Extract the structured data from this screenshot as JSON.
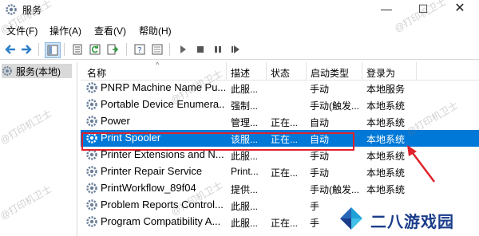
{
  "window": {
    "title": "服务",
    "minimize": "—",
    "maximize": "☐",
    "close": "✕"
  },
  "menu": [
    "文件(F)",
    "操作(A)",
    "查看(V)",
    "帮助(H)"
  ],
  "tree": {
    "root_label": "服务(本地)"
  },
  "columns": {
    "name": "名称",
    "desc": "描述",
    "status": "状态",
    "startup": "启动类型",
    "logon": "登录为"
  },
  "services": [
    {
      "name": "PNRP Machine Name Pu...",
      "desc": "此服...",
      "status": "",
      "startup": "手动",
      "logon": "本地服务"
    },
    {
      "name": "Portable Device Enumera...",
      "desc": "强制...",
      "status": "",
      "startup": "手动(触发...",
      "logon": "本地系统"
    },
    {
      "name": "Power",
      "desc": "管理...",
      "status": "正在...",
      "startup": "自动",
      "logon": "本地系统"
    },
    {
      "name": "Print Spooler",
      "desc": "该服...",
      "status": "正在...",
      "startup": "自动",
      "logon": "本地系统",
      "selected": true
    },
    {
      "name": "Printer Extensions and N...",
      "desc": "此服...",
      "status": "",
      "startup": "手动",
      "logon": "本地系统"
    },
    {
      "name": "Printer Repair Service",
      "desc": "Print...",
      "status": "正在...",
      "startup": "手动",
      "logon": "本地系统"
    },
    {
      "name": "PrintWorkflow_89f04",
      "desc": "提供...",
      "status": "",
      "startup": "手动(触发...",
      "logon": "本地系统"
    },
    {
      "name": "Problem Reports Control...",
      "desc": "此服...",
      "status": "",
      "startup": "手",
      "logon": ""
    },
    {
      "name": "Program Compatibility A...",
      "desc": "此服...",
      "status": "正在...",
      "startup": "手",
      "logon": ""
    }
  ],
  "watermark": "@打印机卫士",
  "logo": {
    "text": "二八游戏园"
  },
  "colors": {
    "selection": "#0078d7",
    "highlight_box": "#e0202a",
    "arrow": "#e0202a"
  }
}
